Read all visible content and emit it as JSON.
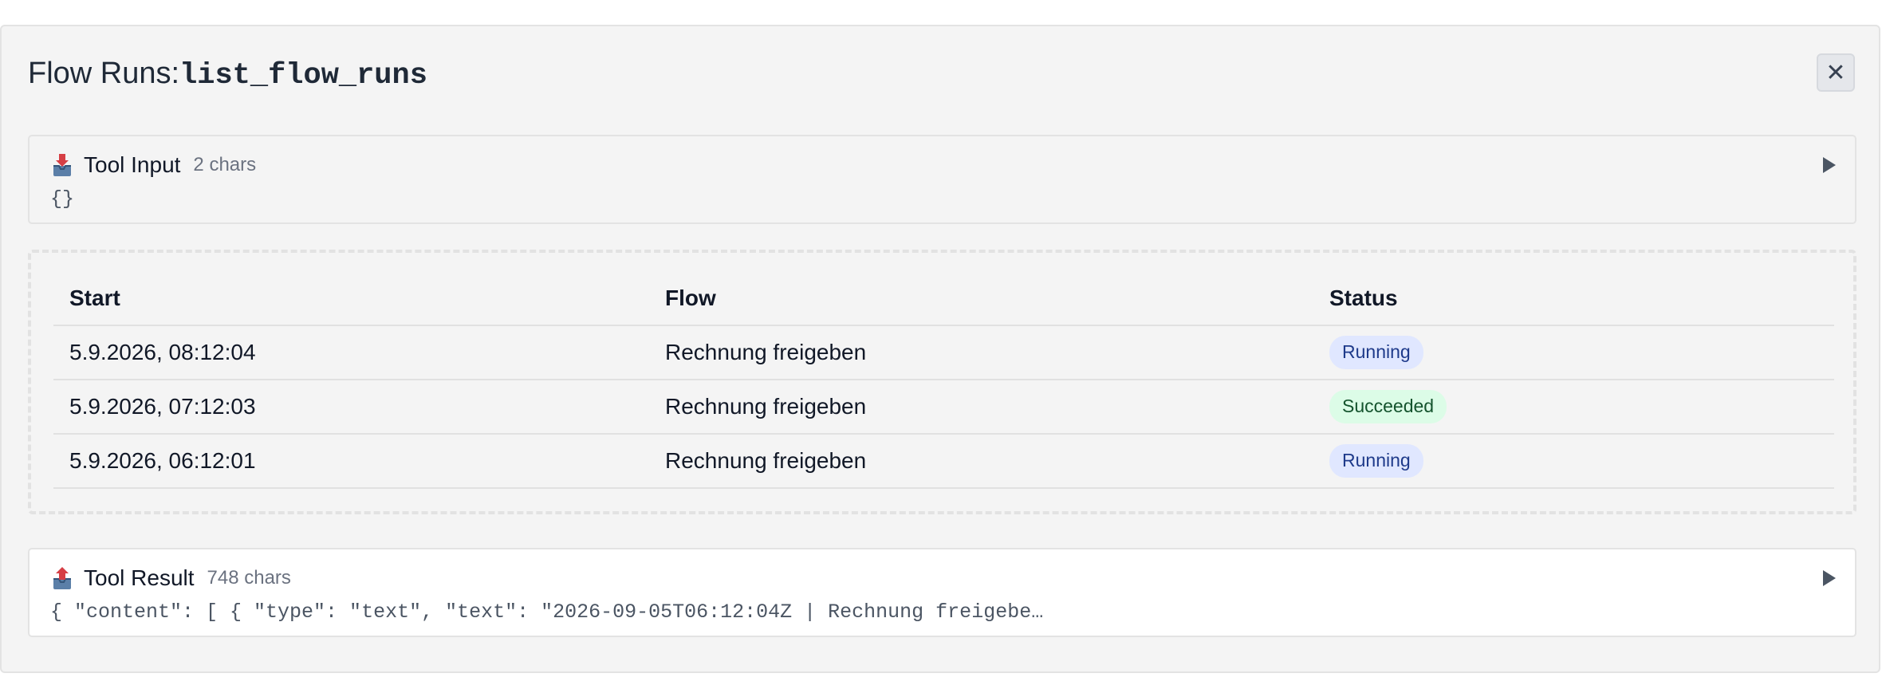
{
  "dialog": {
    "title_prefix": "Flow Runs:",
    "tool_name": "list_flow_runs",
    "close_label": "✕"
  },
  "tool_input": {
    "title": "Tool Input",
    "count": "2 chars",
    "body": "{}"
  },
  "runs_table": {
    "headers": {
      "start": "Start",
      "flow": "Flow",
      "status": "Status"
    },
    "rows": [
      {
        "start": "5.9.2026, 08:12:04",
        "flow": "Rechnung freigeben",
        "status": "Running"
      },
      {
        "start": "5.9.2026, 07:12:03",
        "flow": "Rechnung freigeben",
        "status": "Succeeded"
      },
      {
        "start": "5.9.2026, 06:12:01",
        "flow": "Rechnung freigeben",
        "status": "Running"
      }
    ]
  },
  "tool_result": {
    "title": "Tool Result",
    "count": "748 chars",
    "body": "{ \"content\": [ { \"type\": \"text\", \"text\": \"2026-09-05T06:12:04Z | Rechnung freigebe…"
  },
  "icons": {
    "input": "inbox-tray-icon",
    "result": "outbox-tray-icon",
    "expand": "play-triangle-icon",
    "close": "close-icon"
  },
  "colors": {
    "running_bg": "#e0e7ff",
    "running_fg": "#1e3a8a",
    "succeeded_bg": "#dcfce7",
    "succeeded_fg": "#14532d"
  }
}
